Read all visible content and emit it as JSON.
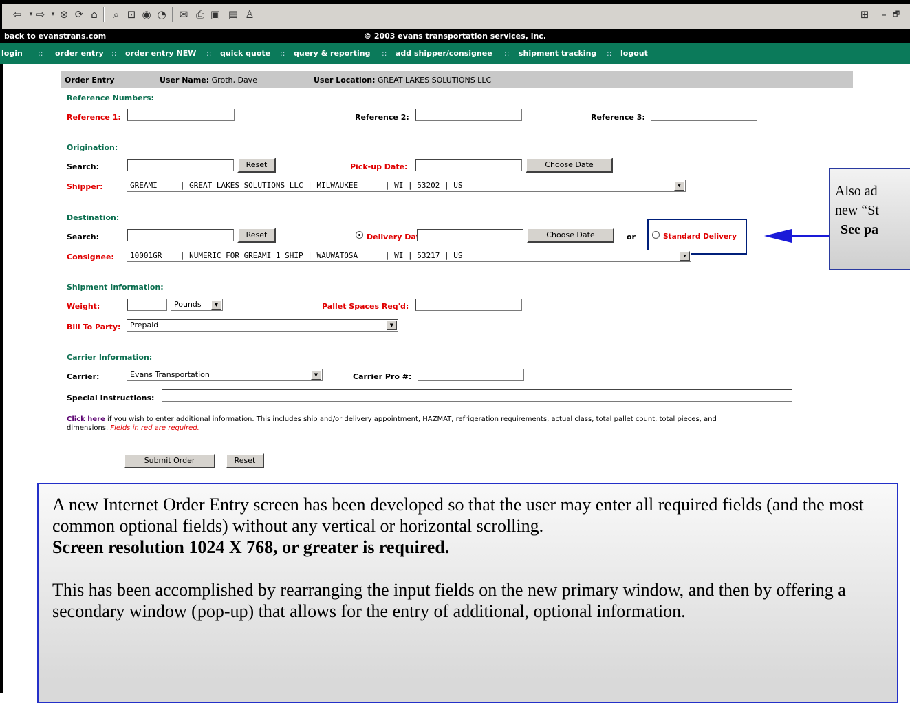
{
  "browser": {
    "toolbar_icons": [
      "back-icon",
      "forward-icon",
      "stop-icon",
      "refresh-icon",
      "home-icon",
      "search-icon",
      "favorites-icon",
      "media-icon",
      "history-icon",
      "mail-icon",
      "print-icon",
      "edit-icon",
      "discuss-icon",
      "messenger-icon"
    ],
    "window_controls": {
      "minimize": "–",
      "restore": "🗗"
    }
  },
  "site": {
    "back_link": "back to evanstrans.com",
    "copyright": "© 2003 evans transportation services, inc."
  },
  "nav": {
    "items": [
      "login",
      "order entry",
      "order entry NEW",
      "quick quote",
      "query & reporting",
      "add shipper/consignee",
      "shipment tracking",
      "logout"
    ],
    "separator": "::"
  },
  "header": {
    "title": "Order Entry",
    "user_name_label": "User Name:",
    "user_name": "Groth, Dave",
    "user_location_label": "User Location:",
    "user_location": "GREAT LAKES SOLUTIONS LLC"
  },
  "reference": {
    "section": "Reference Numbers:",
    "ref1_label": "Reference 1:",
    "ref2_label": "Reference 2:",
    "ref3_label": "Reference 3:"
  },
  "origination": {
    "section": "Origination:",
    "search_label": "Search:",
    "reset": "Reset",
    "pickup_label": "Pick-up Date:",
    "choose_date": "Choose Date",
    "shipper_label": "Shipper:",
    "shipper_value": "GREAMI     | GREAT LAKES SOLUTIONS LLC | MILWAUKEE      | WI | 53202 | US"
  },
  "destination": {
    "section": "Destination:",
    "search_label": "Search:",
    "reset": "Reset",
    "delivery_label": "Delivery Date:",
    "choose_date": "Choose Date",
    "or": "or",
    "standard_delivery": "Standard Delivery",
    "consignee_label": "Consignee:",
    "consignee_value": "10001GR    | NUMERIC FOR GREAMI 1 SHIP | WAUWATOSA      | WI | 53217 | US"
  },
  "shipment": {
    "section": "Shipment Information:",
    "weight_label": "Weight:",
    "weight_unit": "Pounds",
    "pallet_label": "Pallet Spaces Req'd:",
    "bill_to_label": "Bill To Party:",
    "bill_to_value": "Prepaid"
  },
  "carrier": {
    "section": "Carrier Information:",
    "carrier_label": "Carrier:",
    "carrier_value": "Evans Transportation",
    "pro_label": "Carrier Pro #:",
    "special_label": "Special Instructions:"
  },
  "info": {
    "link": "Click here",
    "text": " if you wish to enter additional information. This includes ship and/or delivery appointment, HAZMAT, refrigeration requirements, actual class, total pallet count, total pieces, and",
    "text2": "dimensions. ",
    "required_note": "Fields in red are required."
  },
  "actions": {
    "submit": "Submit Order",
    "reset": "Reset"
  },
  "callout_right": {
    "line1": "Also ad",
    "line2": "new “St",
    "line3": "See pa"
  },
  "callout_main": {
    "p1": "A new Internet Order Entry screen has been developed so that the user may enter all required fields (and the most common optional fields) without any vertical or horizontal scrolling.",
    "p1_bold": "Screen resolution 1024 X 768, or greater is required.",
    "p2": "This has been accomplished by rearranging the input fields on the new primary window, and then by offering a secondary window (pop-up) that allows for the entry of additional, optional information."
  },
  "colors": {
    "nav_bg": "#0b7a5a",
    "section_green": "#0b6e4f",
    "required_red": "#e00000",
    "callout_border": "#2430c8"
  }
}
